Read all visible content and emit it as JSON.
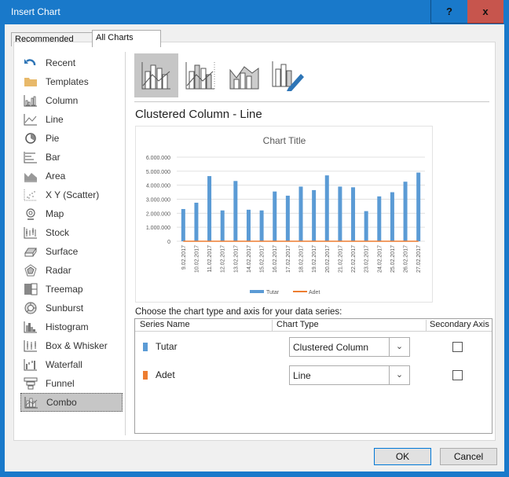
{
  "window": {
    "title": "Insert Chart",
    "help_label": "?",
    "close_label": "x"
  },
  "tabs": [
    {
      "label": "Recommended Charts",
      "active": false
    },
    {
      "label": "All Charts",
      "active": true
    }
  ],
  "sidebar": {
    "items": [
      {
        "label": "Recent",
        "icon": "recent-icon"
      },
      {
        "label": "Templates",
        "icon": "templates-folder-icon"
      },
      {
        "label": "Column",
        "icon": "column-chart-icon"
      },
      {
        "label": "Line",
        "icon": "line-chart-icon"
      },
      {
        "label": "Pie",
        "icon": "pie-chart-icon"
      },
      {
        "label": "Bar",
        "icon": "bar-chart-icon"
      },
      {
        "label": "Area",
        "icon": "area-chart-icon"
      },
      {
        "label": "X Y (Scatter)",
        "icon": "scatter-chart-icon"
      },
      {
        "label": "Map",
        "icon": "map-chart-icon"
      },
      {
        "label": "Stock",
        "icon": "stock-chart-icon"
      },
      {
        "label": "Surface",
        "icon": "surface-chart-icon"
      },
      {
        "label": "Radar",
        "icon": "radar-chart-icon"
      },
      {
        "label": "Treemap",
        "icon": "treemap-chart-icon"
      },
      {
        "label": "Sunburst",
        "icon": "sunburst-chart-icon"
      },
      {
        "label": "Histogram",
        "icon": "histogram-chart-icon"
      },
      {
        "label": "Box & Whisker",
        "icon": "box-whisker-chart-icon"
      },
      {
        "label": "Waterfall",
        "icon": "waterfall-chart-icon"
      },
      {
        "label": "Funnel",
        "icon": "funnel-chart-icon"
      },
      {
        "label": "Combo",
        "icon": "combo-chart-icon",
        "selected": true
      }
    ]
  },
  "subtypes": [
    {
      "name": "clustered-column-line",
      "selected": true
    },
    {
      "name": "clustered-column-line-secondary-axis",
      "selected": false
    },
    {
      "name": "stacked-area-clustered-column",
      "selected": false
    },
    {
      "name": "custom-combination",
      "selected": false
    }
  ],
  "combo_title": "Clustered Column - Line",
  "chart_data": {
    "type": "bar",
    "title": "Chart Title",
    "xlabel": "",
    "ylabel": "",
    "ylim": [
      0,
      6000000
    ],
    "yticks": [
      "0",
      "1.000.000",
      "2.000.000",
      "3.000.000",
      "4.000.000",
      "5.000.000",
      "6.000.000"
    ],
    "categories": [
      "9.02.2017",
      "10.02.2017",
      "11.02.2017",
      "12.02.2017",
      "13.02.2017",
      "14.02.2017",
      "15.02.2017",
      "16.02.2017",
      "17.02.2017",
      "18.02.2017",
      "19.02.2017",
      "20.02.2017",
      "21.02.2017",
      "22.02.2017",
      "23.02.2017",
      "24.02.2017",
      "25.02.2017",
      "26.02.2017",
      "27.02.2017"
    ],
    "series": [
      {
        "name": "Tutar",
        "kind": "column",
        "color": "#5b9bd5",
        "values": [
          2300000,
          2750000,
          4650000,
          2200000,
          4300000,
          2250000,
          2200000,
          3550000,
          3250000,
          3900000,
          3650000,
          4700000,
          3900000,
          3850000,
          2150000,
          3200000,
          3500000,
          4250000,
          4900000
        ]
      },
      {
        "name": "Adet",
        "kind": "line",
        "color": "#ed7d31",
        "values": [
          0,
          0,
          0,
          0,
          0,
          0,
          0,
          0,
          0,
          0,
          0,
          0,
          0,
          0,
          0,
          0,
          0,
          0,
          0
        ]
      }
    ],
    "grid": true,
    "legend": "bottom"
  },
  "series_config": {
    "prompt": "Choose the chart type and axis for your data series:",
    "headers": {
      "name": "Series Name",
      "type": "Chart Type",
      "secondary": "Secondary Axis"
    },
    "rows": [
      {
        "name": "Tutar",
        "color": "#5b9bd5",
        "chart_type": "Clustered Column",
        "secondary_axis": false
      },
      {
        "name": "Adet",
        "color": "#ed7d31",
        "chart_type": "Line",
        "secondary_axis": false
      }
    ]
  },
  "buttons": {
    "ok": "OK",
    "cancel": "Cancel"
  }
}
